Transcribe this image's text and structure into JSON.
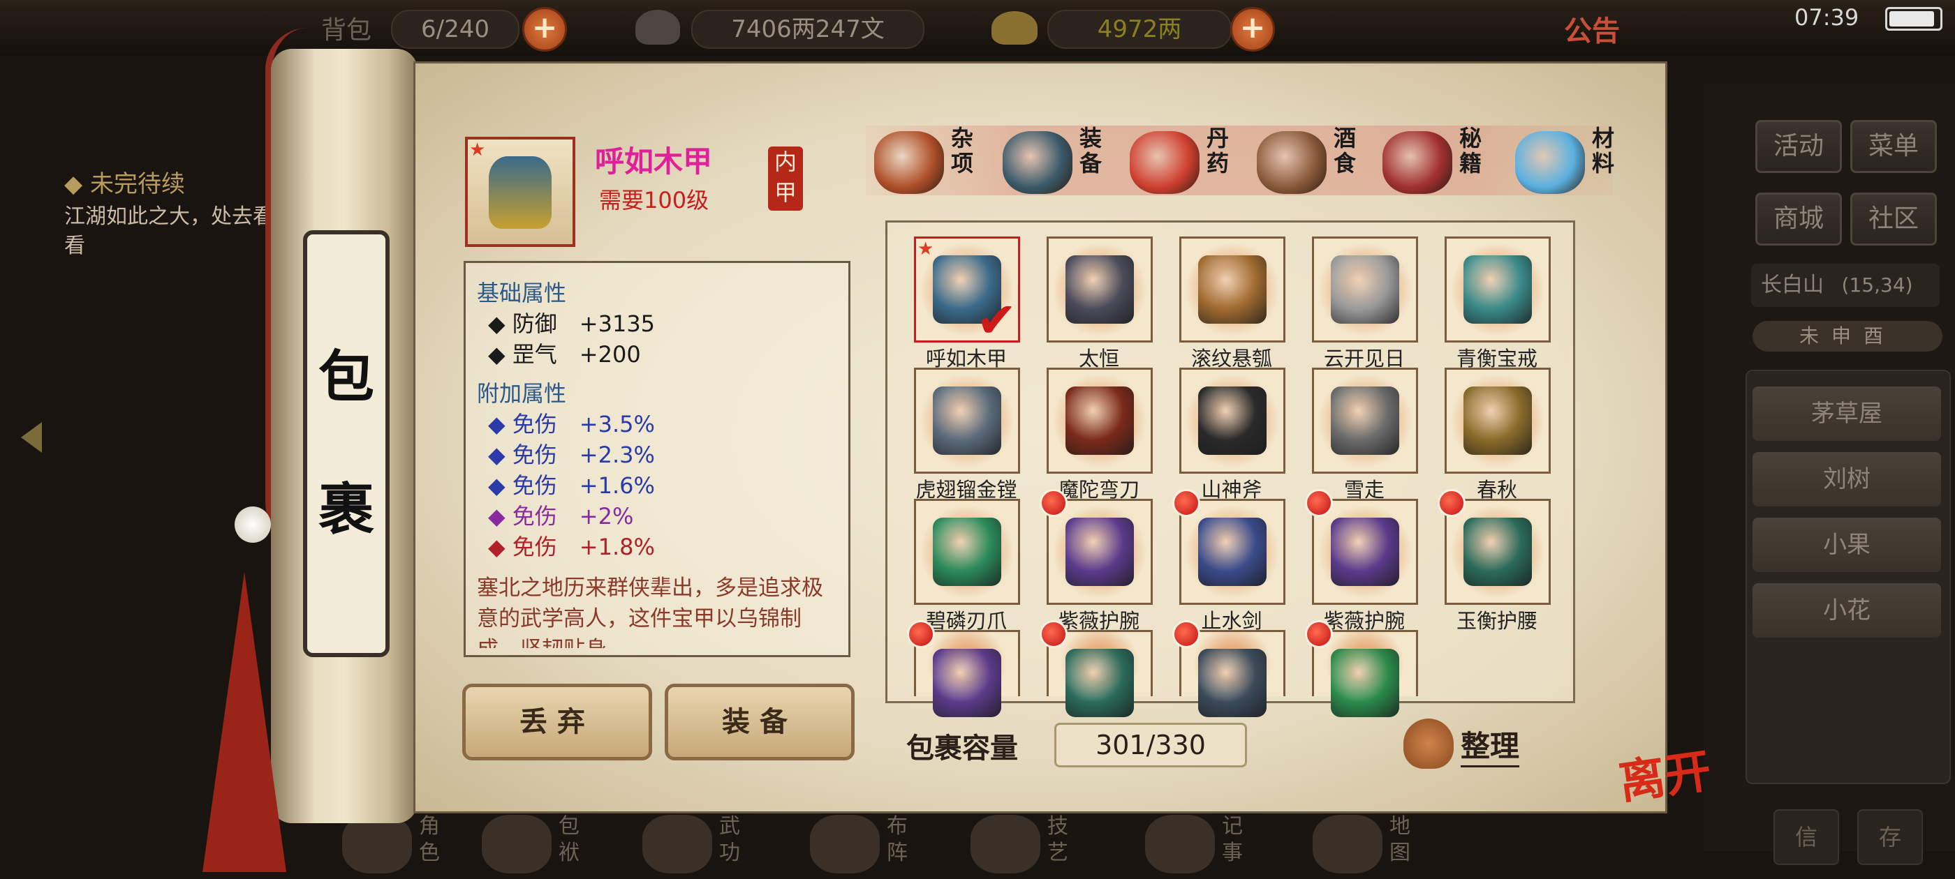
{
  "topbar": {
    "bag_label": "背包",
    "bag_count": "6/240",
    "silver": "7406两247文",
    "gold": "4972两",
    "notice": "公告",
    "clock": "07:39"
  },
  "quest": {
    "title": "◆ 未完待续",
    "text": "江湖如此之大，处去看看"
  },
  "right_menu": {
    "buttons": [
      "活动",
      "菜单",
      "商城",
      "社区"
    ],
    "location": "长白山",
    "coords": "(15,34)",
    "time_strip": "未申酉",
    "npcs": [
      "茅草屋",
      "刘树",
      "小果",
      "小花"
    ],
    "bottom_buttons": [
      "信",
      "存"
    ]
  },
  "scroll": {
    "title_top": "包",
    "title_bottom": "裹"
  },
  "selected_item": {
    "name": "呼如木甲",
    "requirement": "需要100级",
    "type_tag": "内甲",
    "base_header": "基础属性",
    "base_stats": [
      "◆ 防御　+3135",
      "◆ 罡气　+200"
    ],
    "extra_header": "附加属性",
    "extra_stats": [
      {
        "text": "◆ 免伤　+3.5%",
        "color": "#2a3aa8"
      },
      {
        "text": "◆ 免伤　+2.3%",
        "color": "#2a3aa8"
      },
      {
        "text": "◆ 免伤　+1.6%",
        "color": "#2a3aa8"
      },
      {
        "text": "◆ 免伤　+2%",
        "color": "#8a2aa0"
      },
      {
        "text": "◆ 免伤　+1.8%",
        "color": "#b0202a"
      }
    ],
    "description": "塞北之地历来群侠辈出，多是追求极意的武学高人，这件宝甲以乌锦制成，坚韧贴身，..."
  },
  "actions": {
    "discard": "丢弃",
    "equip": "装备"
  },
  "tabs": [
    {
      "label": "杂项",
      "color": "#b0502a"
    },
    {
      "label": "装备",
      "color": "#3a5a6a"
    },
    {
      "label": "丹药",
      "color": "#d04030"
    },
    {
      "label": "酒食",
      "color": "#8a5a3a"
    },
    {
      "label": "秘籍",
      "color": "#a03030"
    },
    {
      "label": "材料",
      "color": "#5ab0e0"
    }
  ],
  "items": [
    {
      "name": "呼如木甲",
      "color": "#3a6a8a",
      "selected": true,
      "star": true,
      "dot": false
    },
    {
      "name": "太恒",
      "color": "#4a4a5a",
      "selected": false,
      "dot": false
    },
    {
      "name": "滚纹悬瓠",
      "color": "#a06a30",
      "selected": false,
      "dot": false
    },
    {
      "name": "云开见日",
      "color": "#9a9a9a",
      "selected": false,
      "dot": false
    },
    {
      "name": "青衡宝戒",
      "color": "#3a8a8a",
      "selected": false,
      "dot": false
    },
    {
      "name": "虎翅镏金镗",
      "color": "#5a6a7a",
      "selected": false,
      "dot": false
    },
    {
      "name": "魔陀弯刀",
      "color": "#7a2a1a",
      "selected": false,
      "dot": false
    },
    {
      "name": "山神斧",
      "color": "#2a2a2a",
      "selected": false,
      "dot": false
    },
    {
      "name": "雪走",
      "color": "#6a6a6a",
      "selected": false,
      "dot": false
    },
    {
      "name": "春秋",
      "color": "#8a6a2a",
      "selected": false,
      "dot": false
    },
    {
      "name": "碧磷刃爪",
      "color": "#2a8a5a",
      "selected": false,
      "dot": false
    },
    {
      "name": "紫薇护腕",
      "color": "#5a3a8a",
      "selected": false,
      "dot": true
    },
    {
      "name": "止水剑",
      "color": "#3a4a8a",
      "selected": false,
      "dot": true
    },
    {
      "name": "紫薇护腕",
      "color": "#5a3a8a",
      "selected": false,
      "dot": true
    },
    {
      "name": "玉衡护腰",
      "color": "#2a6a5a",
      "selected": false,
      "dot": true
    },
    {
      "name": "",
      "color": "#5a3a8a",
      "selected": false,
      "dot": true
    },
    {
      "name": "",
      "color": "#2a6a5a",
      "selected": false,
      "dot": true
    },
    {
      "name": "",
      "color": "#3a4a5a",
      "selected": false,
      "dot": true
    },
    {
      "name": "",
      "color": "#2a8a4a",
      "selected": false,
      "dot": true
    }
  ],
  "capacity": {
    "label": "包裹容量",
    "value": "301/330"
  },
  "sort_label": "整理",
  "leave_label": "离开",
  "bottom_nav": [
    {
      "label": "角色"
    },
    {
      "label": "包袱"
    },
    {
      "label": "武功"
    },
    {
      "label": "布阵"
    },
    {
      "label": "技艺"
    },
    {
      "label": "记事"
    },
    {
      "label": "地图"
    }
  ]
}
